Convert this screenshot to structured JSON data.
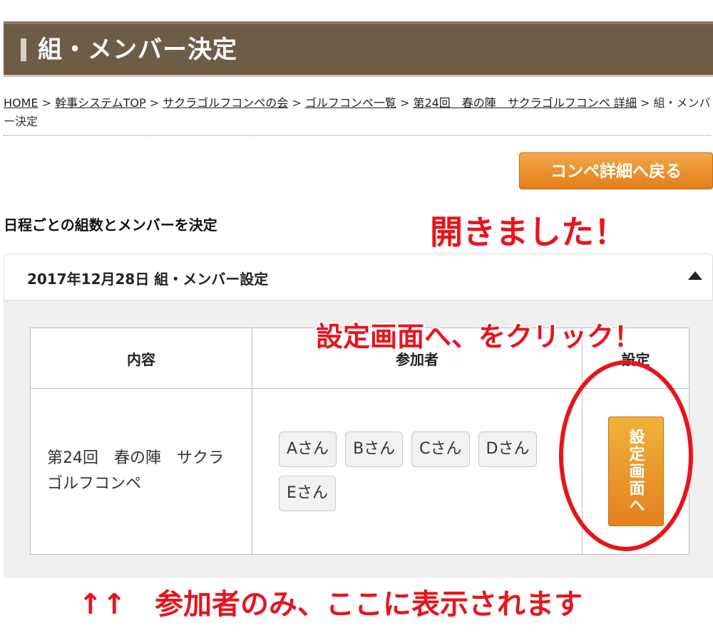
{
  "header": {
    "title": "組・メンバー決定"
  },
  "breadcrumb": {
    "items": [
      "HOME",
      "幹事システムTOP",
      "サクラゴルフコンペの会",
      "ゴルフコンペ一覧",
      "第24回　春の陣　サクラゴルフコンペ 詳細"
    ],
    "separator": " > ",
    "current": "組・メンバー決定"
  },
  "back_button": {
    "label": "コンペ詳細へ戻る"
  },
  "section": {
    "label": "日程ごとの組数とメンバーを決定"
  },
  "accordion": {
    "title": "2017年12月28日 組・メンバー設定",
    "state_icon": "caret-up-icon"
  },
  "table": {
    "headers": [
      "内容",
      "参加者",
      "設定"
    ],
    "rows": [
      {
        "content": "第24回　春の陣　サクラゴルフコンペ",
        "participants": [
          "Aさん",
          "Bさん",
          "Cさん",
          "Dさん",
          "Eさん"
        ],
        "action_label": "設定画面へ"
      }
    ]
  },
  "annotations": {
    "opened": "開きました！",
    "click_hint": "設定画面へ、をクリック！",
    "bottom_note": "↑↑　参加者のみ、ここに表示されます"
  },
  "colors": {
    "header_bg": "#6e5c47",
    "accent_orange": "#e8891f",
    "annotation_red": "#e8141c",
    "panel_bg": "#efefef"
  }
}
